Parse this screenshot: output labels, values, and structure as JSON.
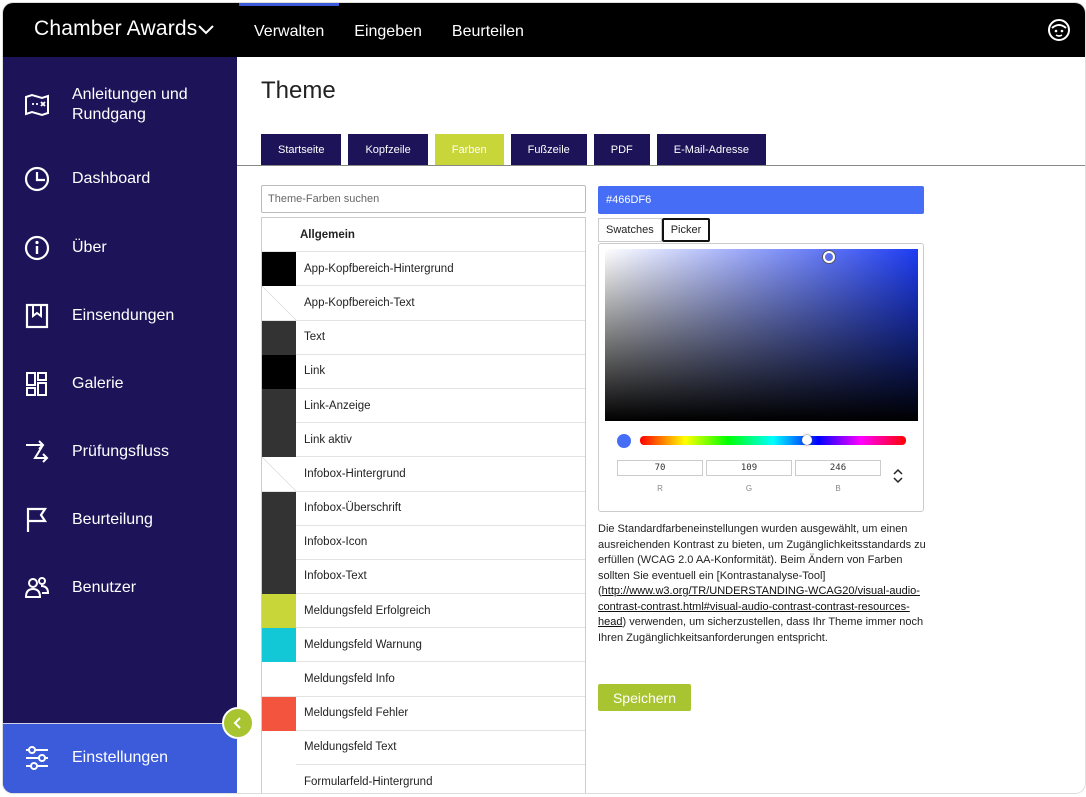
{
  "app": {
    "title": "Chamber Awards"
  },
  "topnav": [
    {
      "label": "Verwalten"
    },
    {
      "label": "Eingeben"
    },
    {
      "label": "Beurteilen"
    }
  ],
  "sidebar": {
    "items": [
      {
        "label": "Anleitungen und Rundgang",
        "icon": "map-icon"
      },
      {
        "label": "Dashboard",
        "icon": "dashboard-gauge-icon"
      },
      {
        "label": "Über",
        "icon": "info-icon"
      },
      {
        "label": "Einsendungen",
        "icon": "bookmark-icon"
      },
      {
        "label": "Galerie",
        "icon": "gallery-grid-icon"
      },
      {
        "label": "Prüfungsfluss",
        "icon": "flow-icon"
      },
      {
        "label": "Beurteilung",
        "icon": "flag-icon"
      },
      {
        "label": "Benutzer",
        "icon": "users-icon"
      }
    ],
    "settings_label": "Einstellungen"
  },
  "main": {
    "title": "Theme",
    "tabs": [
      {
        "label": "Startseite"
      },
      {
        "label": "Kopfzeile"
      },
      {
        "label": "Farben"
      },
      {
        "label": "Fußzeile"
      },
      {
        "label": "PDF"
      },
      {
        "label": "E-Mail-Adresse"
      }
    ],
    "search_placeholder": "Theme-Farben suchen",
    "group_header": "Allgemein",
    "colors": [
      {
        "name": "App-Kopfbereich-Hintergrund",
        "swatch": "#000000"
      },
      {
        "name": "App-Kopfbereich-Text",
        "swatch": "#ffffff"
      },
      {
        "name": "Text",
        "swatch": "#333333"
      },
      {
        "name": "Link",
        "swatch": "#000000"
      },
      {
        "name": "Link-Anzeige",
        "swatch": "#333333"
      },
      {
        "name": "Link aktiv",
        "swatch": "#333333"
      },
      {
        "name": "Infobox-Hintergrund",
        "swatch": "#ffffff"
      },
      {
        "name": "Infobox-Überschrift",
        "swatch": "#333333"
      },
      {
        "name": "Infobox-Icon",
        "swatch": "#333333"
      },
      {
        "name": "Infobox-Text",
        "swatch": "#333333"
      },
      {
        "name": "Meldungsfeld Erfolgreich",
        "swatch": "#c8d63a"
      },
      {
        "name": "Meldungsfeld Warnung",
        "swatch": "#12c7d6"
      },
      {
        "name": "Meldungsfeld Info",
        "swatch": "#ffffff"
      },
      {
        "name": "Meldungsfeld Fehler",
        "swatch": "#f2543d"
      },
      {
        "name": "Meldungsfeld Text",
        "swatch": "#ffffff"
      },
      {
        "name": "Formularfeld-Hintergrund",
        "swatch": "#ffffff"
      }
    ],
    "picker": {
      "hex_value": "#466DF6",
      "tabs": [
        {
          "label": "Swatches"
        },
        {
          "label": "Picker"
        }
      ],
      "r": "70",
      "g": "109",
      "b": "246",
      "r_label": "R",
      "g_label": "G",
      "b_label": "B"
    },
    "info": {
      "text_before": "Die Standardfarbeneinstellungen wurden ausgewählt, um einen ausreichenden Kontrast zu bieten, um Zugänglichkeitsstandards zu erfüllen (WCAG 2.0 AA-Konformität). Beim Ändern von Farben sollten Sie eventuell ein [Kontrastanalyse-Tool] (",
      "link": "http://www.w3.org/TR/UNDERSTANDING-WCAG20/visual-audio-contrast-contrast.html#visual-audio-contrast-contrast-resources-head",
      "text_after": ") verwenden, um sicherzustellen, dass Ihr Theme immer noch Ihren Zugänglichkeitsanforderungen entspricht."
    },
    "save_label": "Speichern"
  },
  "colors": {
    "topbar": "#000000",
    "sidebar": "#1c1358",
    "accent_blue": "#3b5bdb",
    "accent_green": "#a8c431",
    "selected_color": "#466DF6"
  }
}
